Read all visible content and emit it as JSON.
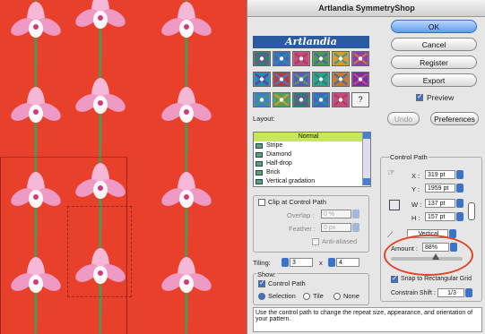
{
  "window": {
    "title": "Artlandia SymmetryShop"
  },
  "logo": {
    "text": "Artlandia"
  },
  "buttons": {
    "ok": "OK",
    "cancel": "Cancel",
    "register": "Register",
    "export": "Export",
    "undo": "Undo",
    "preferences": "Preferences"
  },
  "preview": {
    "label": "Preview",
    "checked": true
  },
  "layout": {
    "label": "Layout:",
    "items": [
      "Normal",
      "Stripe",
      "Diamond",
      "Half-drop",
      "Brick",
      "Vertical gradation"
    ],
    "selected": "Normal"
  },
  "clip": {
    "label": "Clip at Control Path",
    "overlap_label": "Overlap :",
    "overlap_value": "0 %",
    "feather_label": "Feather :",
    "feather_value": "0 px",
    "antialiased_label": "Anti-aliased"
  },
  "tiling": {
    "label": "Tiling:",
    "cols": "3",
    "rows": "4",
    "separator": "x"
  },
  "show": {
    "label": "Show:",
    "control_path_label": "Control Path",
    "options": [
      "Selection",
      "Tile",
      "None"
    ],
    "selected": "Selection"
  },
  "control_path": {
    "label": "Control Path",
    "x_label": "X :",
    "x_value": "319 pt",
    "y_label": "Y :",
    "y_value": "1959 pt",
    "w_label": "W :",
    "w_value": "137 pt",
    "h_label": "H :",
    "h_value": "157 pt",
    "direction": "Vertical",
    "amount_label": "Amount :",
    "amount_value": "88%"
  },
  "snap": {
    "label": "Snap to Rectangular Grid",
    "checked": true
  },
  "constrain": {
    "label": "Constrain Shift :",
    "value": "1/3"
  },
  "hint_text": "Use the control path to change the repeat size, appearance, and orientation of your pattern.",
  "colors": {
    "canvas": "#e8402b",
    "accent": "#3b73c9",
    "highlight_oval": "#e24527",
    "selected_row": "#c8e65a"
  }
}
